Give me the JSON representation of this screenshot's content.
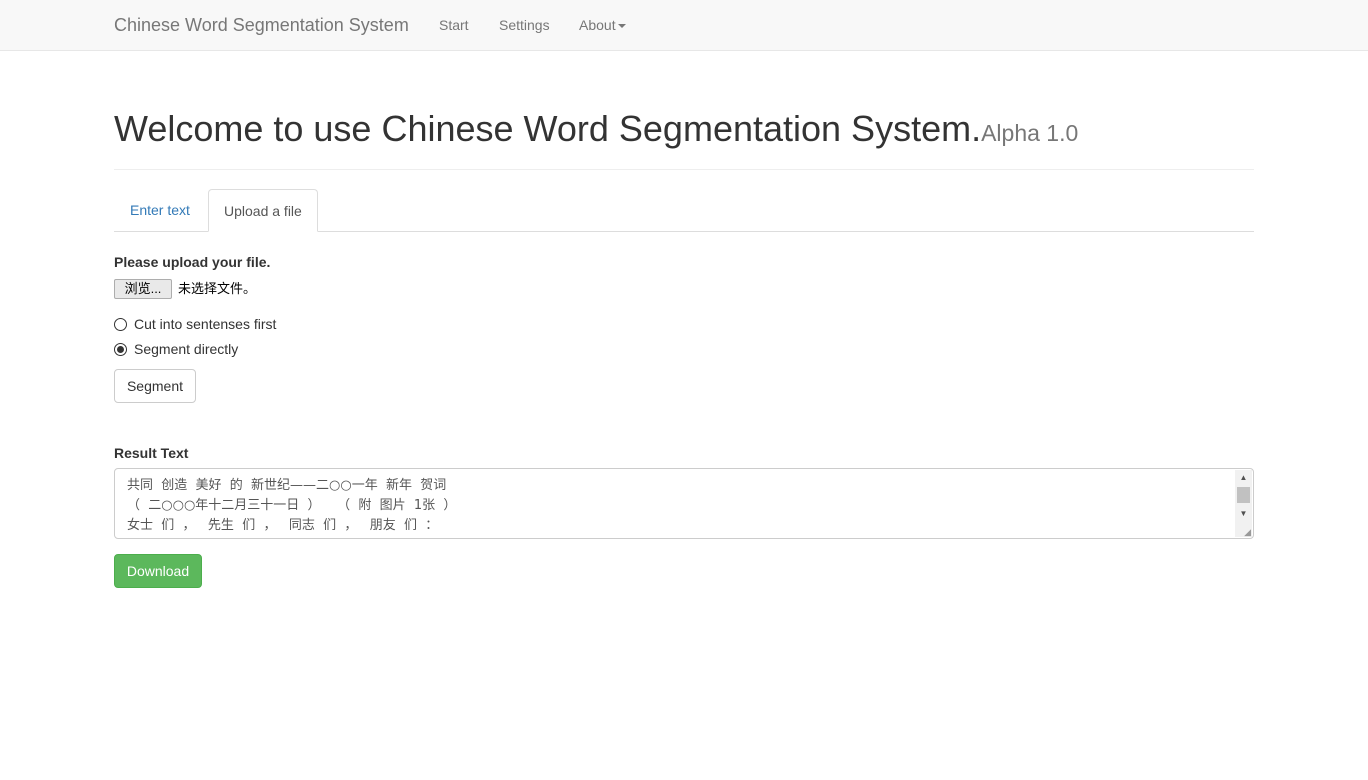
{
  "navbar": {
    "brand": "Chinese Word Segmentation System",
    "links": [
      {
        "label": "Start"
      },
      {
        "label": "Settings"
      },
      {
        "label": "About"
      }
    ]
  },
  "header": {
    "title": "Welcome to use Chinese Word Segmentation System.",
    "version": "Alpha 1.0"
  },
  "tabs": [
    {
      "label": "Enter text",
      "active": false
    },
    {
      "label": "Upload a file",
      "active": true
    }
  ],
  "upload": {
    "label": "Please upload your file.",
    "browse_button": "浏览...",
    "file_status": "未选择文件。"
  },
  "options": [
    {
      "label": "Cut into sentenses first",
      "checked": false
    },
    {
      "label": "Segment directly",
      "checked": true
    }
  ],
  "segment_button": "Segment",
  "result": {
    "label": "Result Text",
    "lines": [
      "共同  创造  美好  的  新世纪——二○○一年  新年  贺词",
      "（  二○○○年十二月三十一日  ）    （  附  图片  1张  ）",
      "女士  们  ，   先生  们  ，   同志  们  ，   朋友  们  ："
    ]
  },
  "download_button": "Download",
  "colors": {
    "navbar_bg": "#f8f8f8",
    "link": "#337ab7",
    "success": "#5cb85c"
  }
}
